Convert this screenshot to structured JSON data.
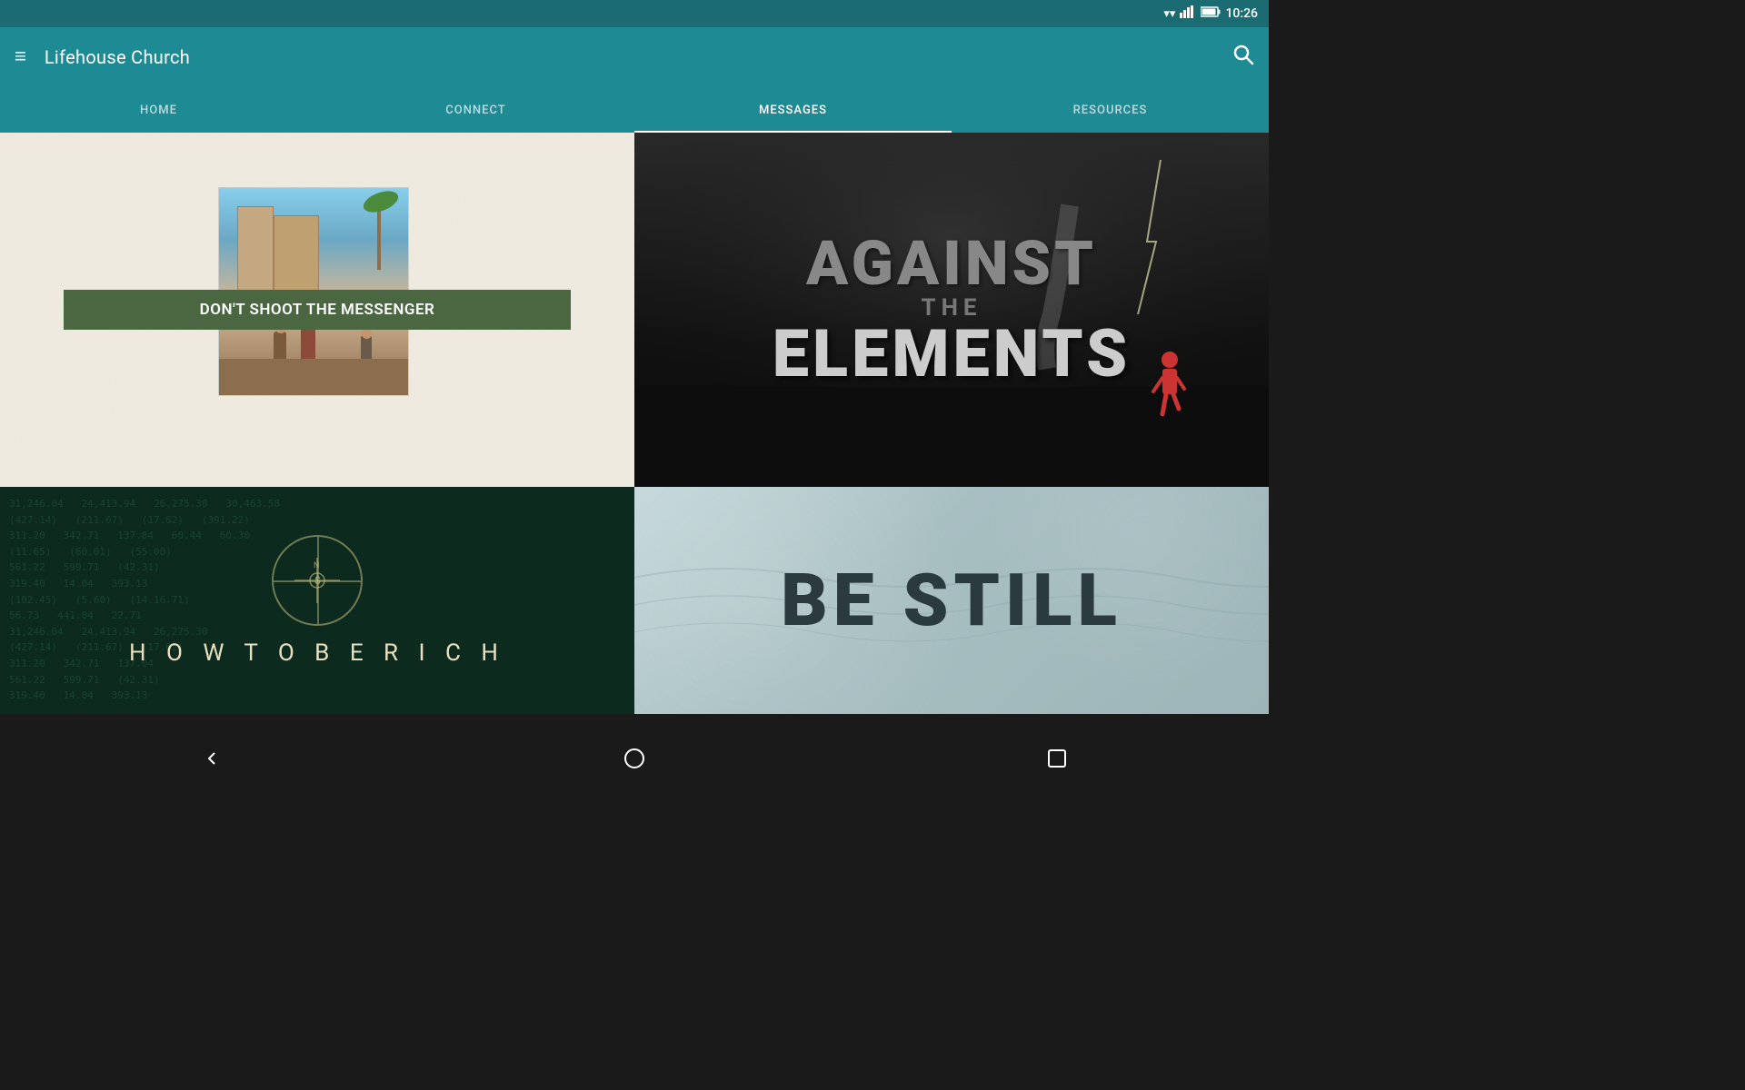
{
  "statusBar": {
    "time": "10:26",
    "wifiIcon": "▼",
    "signalIcon": "▲",
    "batteryIcon": "▮"
  },
  "appBar": {
    "menuIcon": "≡",
    "title": "Lifehouse Church",
    "searchIcon": "🔍"
  },
  "navTabs": [
    {
      "id": "home",
      "label": "HOME",
      "active": false
    },
    {
      "id": "connect",
      "label": "CONNECT",
      "active": false
    },
    {
      "id": "messages",
      "label": "MESSAGES",
      "active": true
    },
    {
      "id": "resources",
      "label": "RESOURCES",
      "active": false
    }
  ],
  "cards": [
    {
      "id": "dont-shoot-messenger",
      "label": "DON'T SHOOT THE MESSENGER",
      "type": "messenger"
    },
    {
      "id": "against-the-elements",
      "against": "AGAINST",
      "the": "THE",
      "elements": "ELEMENTS",
      "type": "elements"
    },
    {
      "id": "how-to-be-rich",
      "title": "H O W   T O   B E   R I C H",
      "type": "rich"
    },
    {
      "id": "be-still",
      "title": "BE STILL",
      "type": "bestill"
    }
  ],
  "bottomNav": {
    "backIcon": "◁",
    "homeIcon": "○",
    "recentIcon": "▢"
  }
}
